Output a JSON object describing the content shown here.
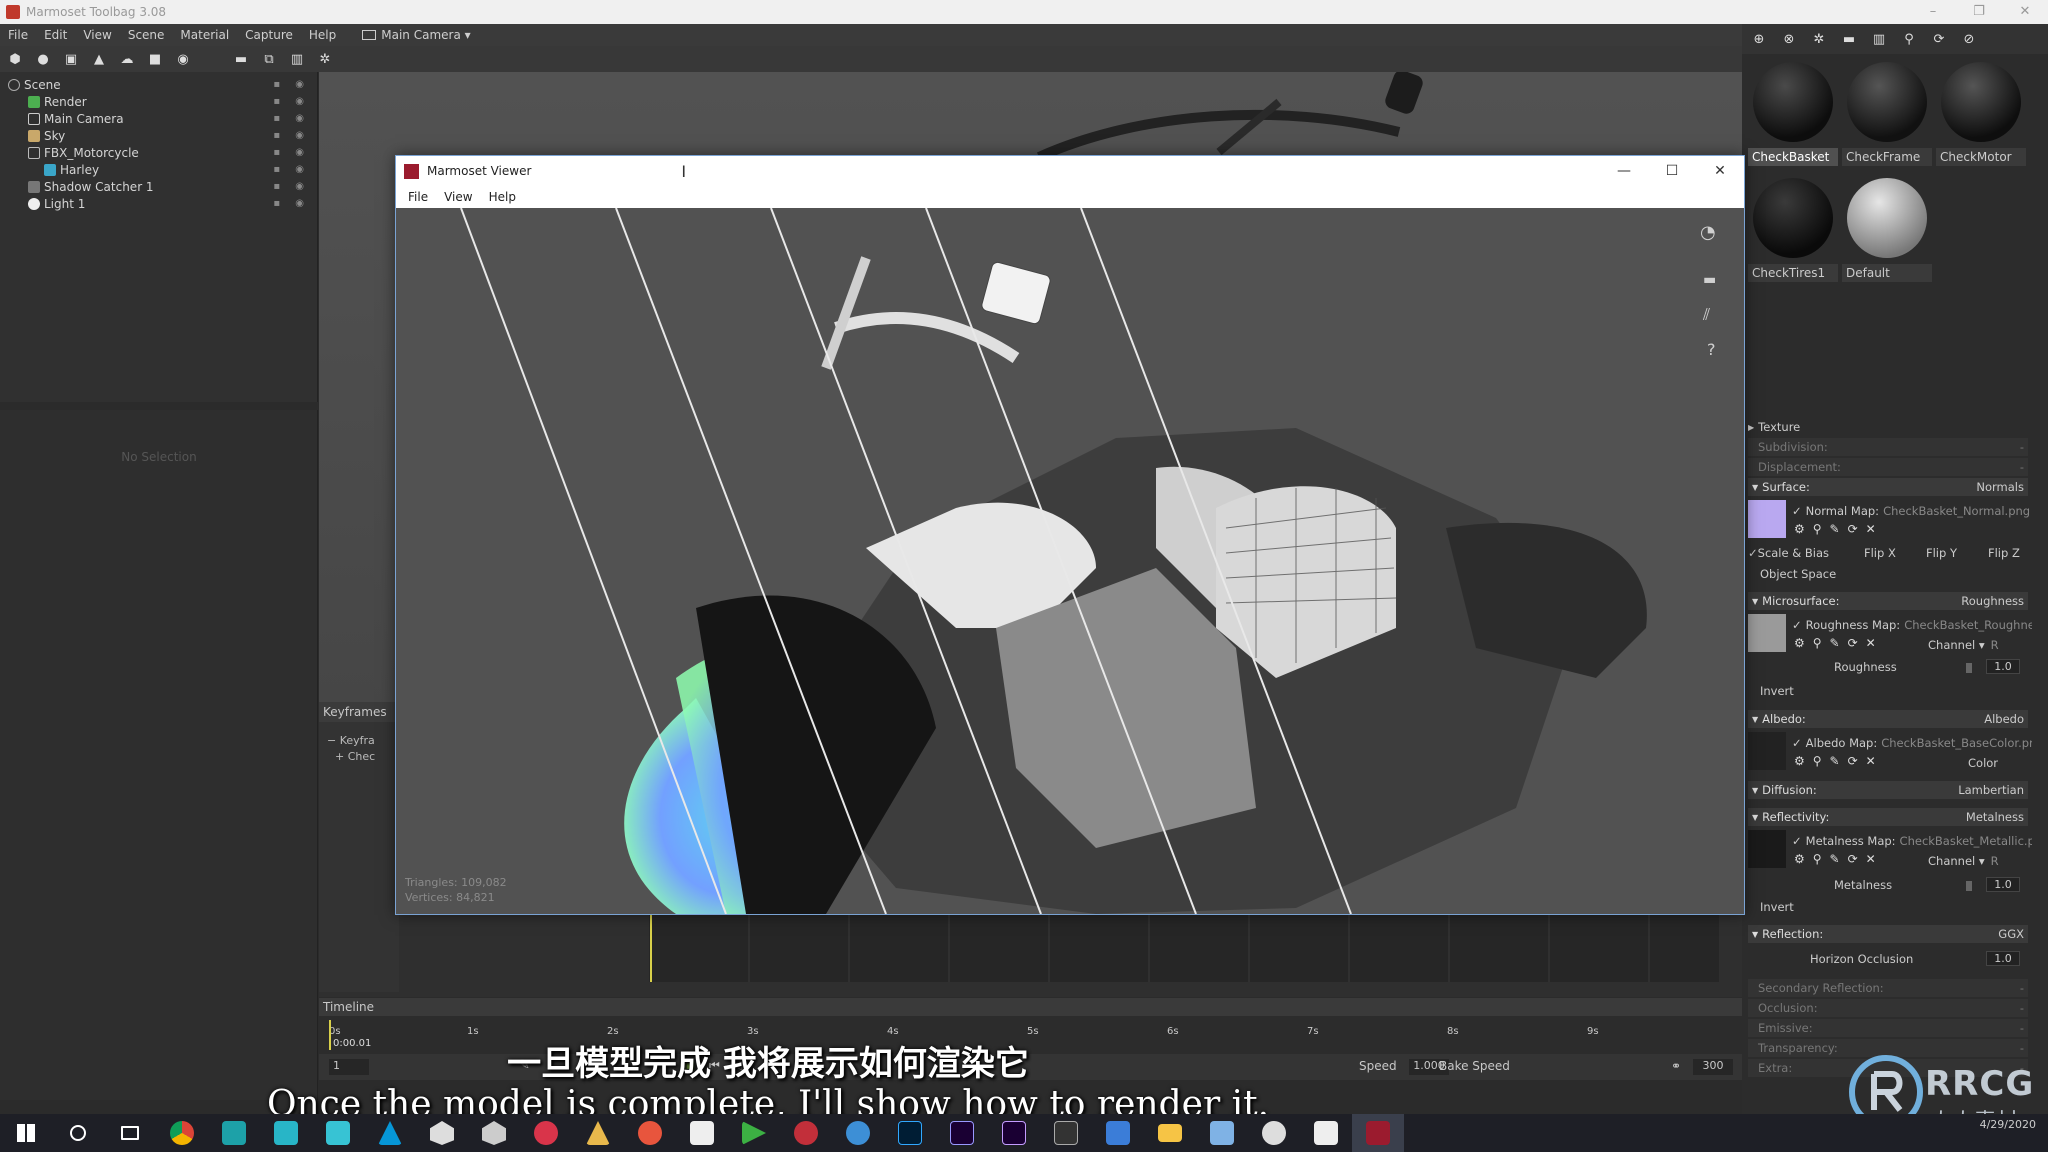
{
  "app": {
    "title": "Marmoset Toolbag 3.08",
    "window_controls": [
      "–",
      "❐",
      "✕"
    ]
  },
  "menubar": {
    "items": [
      "File",
      "Edit",
      "View",
      "Scene",
      "Material",
      "Capture",
      "Help"
    ],
    "camera_selector": "Main Camera ▾"
  },
  "scene": {
    "items": [
      {
        "label": "Scene",
        "icon": "scene-icon",
        "indent": 0
      },
      {
        "label": "Render",
        "icon": "render-icon",
        "indent": 1
      },
      {
        "label": "Main Camera",
        "icon": "camera-icon",
        "indent": 1
      },
      {
        "label": "Sky",
        "icon": "sky-icon",
        "indent": 1
      },
      {
        "label": "FBX_Motorcycle",
        "icon": "mesh-icon",
        "indent": 1
      },
      {
        "label": "Harley",
        "icon": "mesh-icon",
        "indent": 2
      },
      {
        "label": "Shadow Catcher 1",
        "icon": "shadow-icon",
        "indent": 1
      },
      {
        "label": "Light 1",
        "icon": "light-icon",
        "indent": 1
      }
    ],
    "no_selection": "No Selection"
  },
  "keyframes": {
    "header": "Keyframes",
    "items": [
      "Keyfra",
      "Chec"
    ]
  },
  "timeline": {
    "label": "Timeline",
    "ticks": [
      "0s",
      "1s",
      "2s",
      "3s",
      "4s",
      "5s",
      "6s",
      "7s",
      "8s",
      "9s"
    ],
    "current_time": "0:00.01",
    "frame": "1",
    "speed_label": "Speed",
    "speed_value": "1.000",
    "bake_speed": "Bake Speed",
    "end_frame": "300"
  },
  "viewer": {
    "title": "Marmoset Viewer",
    "menu": [
      "File",
      "View",
      "Help"
    ],
    "stats_triangles": "Triangles: 109,082",
    "stats_vertices": "Vertices: 84,821",
    "window_controls": [
      "—",
      "☐",
      "✕"
    ],
    "help": "?"
  },
  "materials": {
    "swatches": [
      {
        "label": "CheckBasket",
        "selected": true
      },
      {
        "label": "CheckFrame",
        "selected": false
      },
      {
        "label": "CheckMotor",
        "selected": false
      },
      {
        "label": "CheckTires1",
        "selected": false
      },
      {
        "label": "Default",
        "selected": false
      }
    ]
  },
  "props": {
    "texture": "Texture",
    "subdivision": "Subdivision:",
    "displacement": "Displacement:",
    "dash": "-",
    "surface": {
      "label": "Surface:",
      "value": "Normals"
    },
    "normal_map": "Normal Map:",
    "normal_map_file": "CheckBasket_Normal.png",
    "scale_bias": "Scale & Bias",
    "flip_x": "Flip X",
    "flip_y": "Flip Y",
    "flip_z": "Flip Z",
    "object_space": "Object Space",
    "microsurface": {
      "label": "Microsurface:",
      "value": "Roughness"
    },
    "roughness_map": "Roughness Map:",
    "roughness_map_file": "CheckBasket_Roughne",
    "channel": "Channel ▾",
    "channel_r": "R",
    "roughness_label": "Roughness",
    "roughness_value": "1.0",
    "invert": "Invert",
    "albedo": {
      "label": "Albedo:",
      "value": "Albedo"
    },
    "albedo_map": "Albedo Map:",
    "albedo_map_file": "CheckBasket_BaseColor.pn",
    "color": "Color",
    "diffusion": {
      "label": "Diffusion:",
      "value": "Lambertian"
    },
    "reflectivity": {
      "label": "Reflectivity:",
      "value": "Metalness"
    },
    "metalness_map": "Metalness Map:",
    "metalness_map_file": "CheckBasket_Metallic.p",
    "metalness_label": "Metalness",
    "metalness_value": "1.0",
    "reflection": {
      "label": "Reflection:",
      "value": "GGX"
    },
    "horizon_occlusion": "Horizon Occlusion",
    "horizon_value": "1.0",
    "secondary_reflection": "Secondary Reflection:",
    "occlusion": "Occlusion:",
    "emissive": "Emissive:",
    "transparency": "Transparency:",
    "extra": "Extra:"
  },
  "subtitles": {
    "cn": "一旦模型完成 我将展示如何渲染它",
    "en": "Once the model is complete, I'll show how to render it."
  },
  "watermark": {
    "text": "RRCG",
    "sub": "人人素材"
  },
  "taskbar": {
    "date": "4/29/2020",
    "apps": [
      "windows-start-icon",
      "search-icon",
      "task-view-icon",
      "chrome-icon",
      "app-icon",
      "maya-icon",
      "maya-icon",
      "autodesk-icon",
      "unity-icon",
      "unity-icon",
      "substance-icon",
      "marmoset-icon",
      "app-icon",
      "mail-icon",
      "media-icon",
      "app-icon",
      "app-icon",
      "photoshop-icon",
      "after-effects-icon",
      "premiere-icon",
      "epic-icon",
      "app-icon",
      "folder-icon",
      "app-icon",
      "app-icon",
      "app-icon",
      "marmoset-icon"
    ]
  },
  "colors": {
    "accent": "#7aa3d4",
    "panel": "#2c2c2c",
    "viewer_icon": "#9b1b2e"
  }
}
